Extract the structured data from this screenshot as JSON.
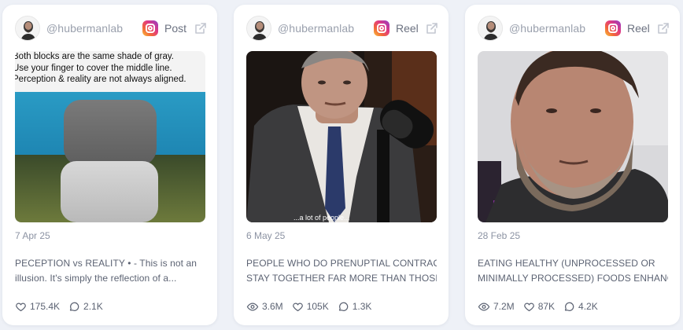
{
  "cards": [
    {
      "handle": "@hubermanlab",
      "platform_icon": "instagram-icon",
      "type": "Post",
      "date": "7 Apr 25",
      "image_text": [
        "Both blocks are the same shade of gray.",
        "Use your finger to cover the middle line.",
        "Perception & reality are not always aligned."
      ],
      "caption": [
        "PECEPTION vs REALITY • - This is not an",
        "illusion. It's simply the reflection of a..."
      ],
      "stats": {
        "likes": "175.4K",
        "comments": "2.1K"
      }
    },
    {
      "handle": "@hubermanlab",
      "platform_icon": "instagram-icon",
      "type": "Reel",
      "date": "6 May 25",
      "subtitle": "...a lot of people...",
      "caption": [
        "PEOPLE WHO DO PRENUPTIAL CONTRACTS",
        "STAY TOGETHER FAR MORE THAN THOSE..."
      ],
      "stats": {
        "views": "3.6M",
        "likes": "105K",
        "comments": "1.3K"
      }
    },
    {
      "handle": "@hubermanlab",
      "platform_icon": "instagram-icon",
      "type": "Reel",
      "date": "28 Feb 25",
      "caption": [
        "EATING HEALTHY (UNPROCESSED OR",
        "MINIMALLY PROCESSED) FOODS ENHANCE..."
      ],
      "stats": {
        "views": "7.2M",
        "likes": "87K",
        "comments": "4.2K"
      }
    }
  ],
  "colors": {
    "background": "#eef1f7",
    "card": "#ffffff",
    "muted_text": "#9aa0ad",
    "body_text": "#5c6373"
  }
}
